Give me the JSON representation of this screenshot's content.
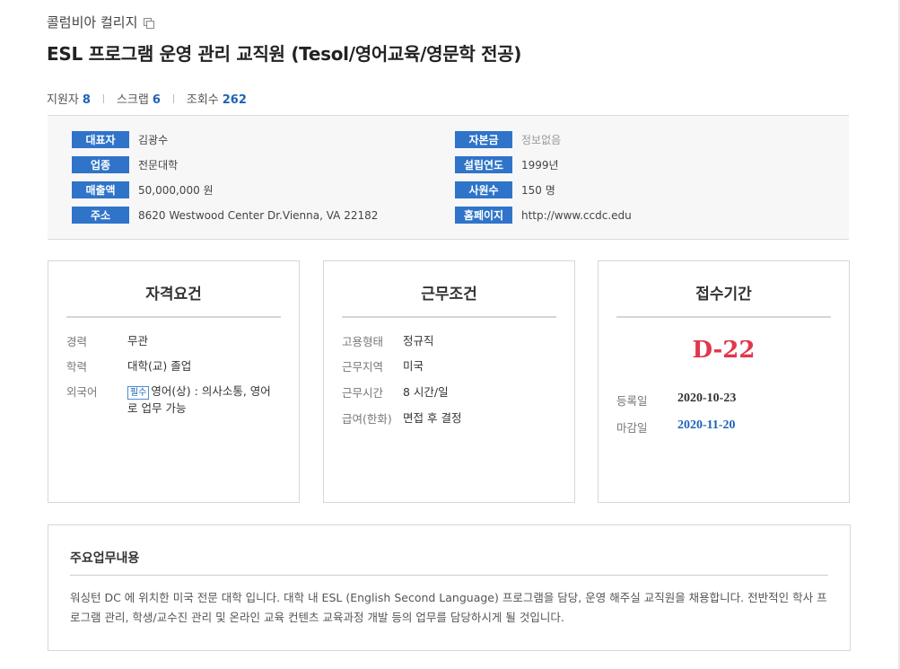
{
  "header": {
    "company": "콜럼비아 컬리지",
    "title": "ESL 프로그램 운영 관리 교직원 (Tesol/영어교육/영문학 전공)"
  },
  "stats": [
    {
      "label": "지원자",
      "value": "8"
    },
    {
      "label": "스크랩",
      "value": "6"
    },
    {
      "label": "조회수",
      "value": "262"
    }
  ],
  "company_info": {
    "left": [
      {
        "label": "대표자",
        "value": "김광수"
      },
      {
        "label": "업종",
        "value": "전문대학"
      },
      {
        "label": "매출액",
        "value": "50,000,000 원"
      },
      {
        "label": "주소",
        "value": "8620 Westwood Center Dr.Vienna, VA 22182"
      }
    ],
    "right": [
      {
        "label": "자본금",
        "value": "정보없음"
      },
      {
        "label": "설립연도",
        "value": "1999년"
      },
      {
        "label": "사원수",
        "value": "150 명"
      },
      {
        "label": "홈페이지",
        "value": "http://www.ccdc.edu"
      }
    ]
  },
  "qualifications": {
    "title": "자격요건",
    "rows": [
      {
        "label": "경력",
        "value": "무관"
      },
      {
        "label": "학력",
        "value": "대학(교) 졸업"
      },
      {
        "label": "외국어",
        "badge": "필수",
        "value": "영어(상) : 의사소통, 영어로 업무 가능"
      }
    ]
  },
  "conditions": {
    "title": "근무조건",
    "rows": [
      {
        "label": "고용형태",
        "value": "정규직"
      },
      {
        "label": "근무지역",
        "value": "미국"
      },
      {
        "label": "근무시간",
        "value": "8 시간/일"
      },
      {
        "label": "급여(한화)",
        "value": "면접 후 결정"
      }
    ]
  },
  "period": {
    "title": "접수기간",
    "dday": "D-22",
    "registered_label": "등록일",
    "registered": "2020-10-23",
    "deadline_label": "마감일",
    "deadline": "2020-11-20"
  },
  "duties": {
    "title": "주요업무내용",
    "text": "워싱턴 DC 에 위치한 미국 전문 대학 입니다. 대학 내 ESL (English Second Language) 프로그램을 담당, 운영 해주실 교직원을 채용합니다. 전반적인 학사 프로그램 관리, 학생/교수진 관리 및 온라인 교육 컨텐츠 교육과정 개발 등의 업무를 담당하시게 될 것입니다."
  },
  "colors": {
    "accent": "#2f74c9",
    "dday": "#e0384c",
    "link": "#1e63b7"
  }
}
